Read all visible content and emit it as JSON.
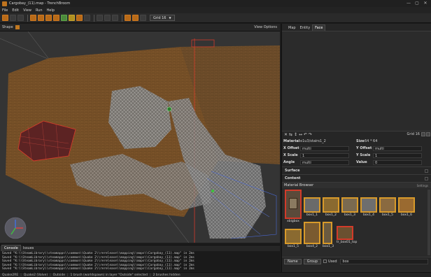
{
  "window": {
    "title": "Cargobay_(11).map - TrenchBroom",
    "controls": [
      "—",
      "▢",
      "✕"
    ]
  },
  "menu": [
    "File",
    "Edit",
    "View",
    "Run",
    "Help"
  ],
  "toolbar": {
    "grid_label": "Grid 16"
  },
  "viewbar": {
    "shape_label": "Shape",
    "view_options": "View Options"
  },
  "panel": {
    "tabs": [
      "Map",
      "Entity",
      "Face"
    ],
    "active_tab": "Face",
    "face_toolbar": {
      "icons": [
        "✕",
        "⇆",
        "↕",
        "↔",
        "↶",
        "↷"
      ],
      "grid_label": "Grid 16"
    },
    "attributes": {
      "material_label": "Material",
      "material_value": "e1u3/stairs1_2",
      "size_label": "Size",
      "size_value": "64 * 64",
      "x_offset_label": "X Offset",
      "x_offset_value": "multi",
      "y_offset_label": "Y Offset",
      "y_offset_value": "multi",
      "x_scale_label": "X Scale",
      "x_scale_value": "1",
      "y_scale_label": "Y Scale",
      "y_scale_value": "1",
      "angle_label": "Angle",
      "angle_value": "multi",
      "value_label": "Value",
      "value_value": "0",
      "surface_label": "Surface",
      "content_label": "Content"
    },
    "material_browser": {
      "title": "Material Browser",
      "options_label": "Settings",
      "textures_row1": [
        "xbigbox",
        "box1_1",
        "box1_2",
        "box1_3",
        "box1_4",
        "box1_5",
        "box1_6"
      ],
      "textures_row2": [
        "box1_5",
        "box4_2",
        "box1_3",
        "tr_box01_top"
      ],
      "footer": {
        "sort_label": "Name",
        "group_label": "Group",
        "used_label": "Used",
        "search_value": "box"
      }
    }
  },
  "console": {
    "tabs": [
      "Console",
      "Issues"
    ],
    "active_tab": "Console",
    "lines": [
      "Saved \"K:\\\\SteamLibrary\\\\steamapps\\\\common\\\\Quake 2\\\\rerelease\\\\mapping\\\\maps\\\\Cargobay_(11).map\" in 2ms",
      "Saved \"K:\\\\SteamLibrary\\\\steamapps\\\\common\\\\Quake 2\\\\rerelease\\\\mapping\\\\maps\\\\Cargobay_(11).map\" in 2ms",
      "Saved \"K:\\\\SteamLibrary\\\\steamapps\\\\common\\\\Quake 2\\\\rerelease\\\\mapping\\\\maps\\\\Cargobay_(11).map\" in 2ms",
      "Saved \"K:\\\\SteamLibrary\\\\steamapps\\\\common\\\\Quake 2\\\\rerelease\\\\mapping\\\\maps\\\\Cargobay_(11).map\" in 2ms",
      "Saved \"K:\\\\SteamLibrary\\\\steamapps\\\\common\\\\Quake 2\\\\rerelease\\\\mapping\\\\maps\\\\Cargobay_(11).map\" in 2ms"
    ]
  },
  "status": {
    "items": [
      "Quake2RE",
      "Quake2 (Valve)",
      "Outside",
      "1 brush (worldspawn) in layer \"Outside\" selected",
      "2 brushes hidden"
    ]
  },
  "colors": {
    "accent": "#c07820",
    "selection": "#d23b2a",
    "texture_border": "#d89a2a"
  }
}
